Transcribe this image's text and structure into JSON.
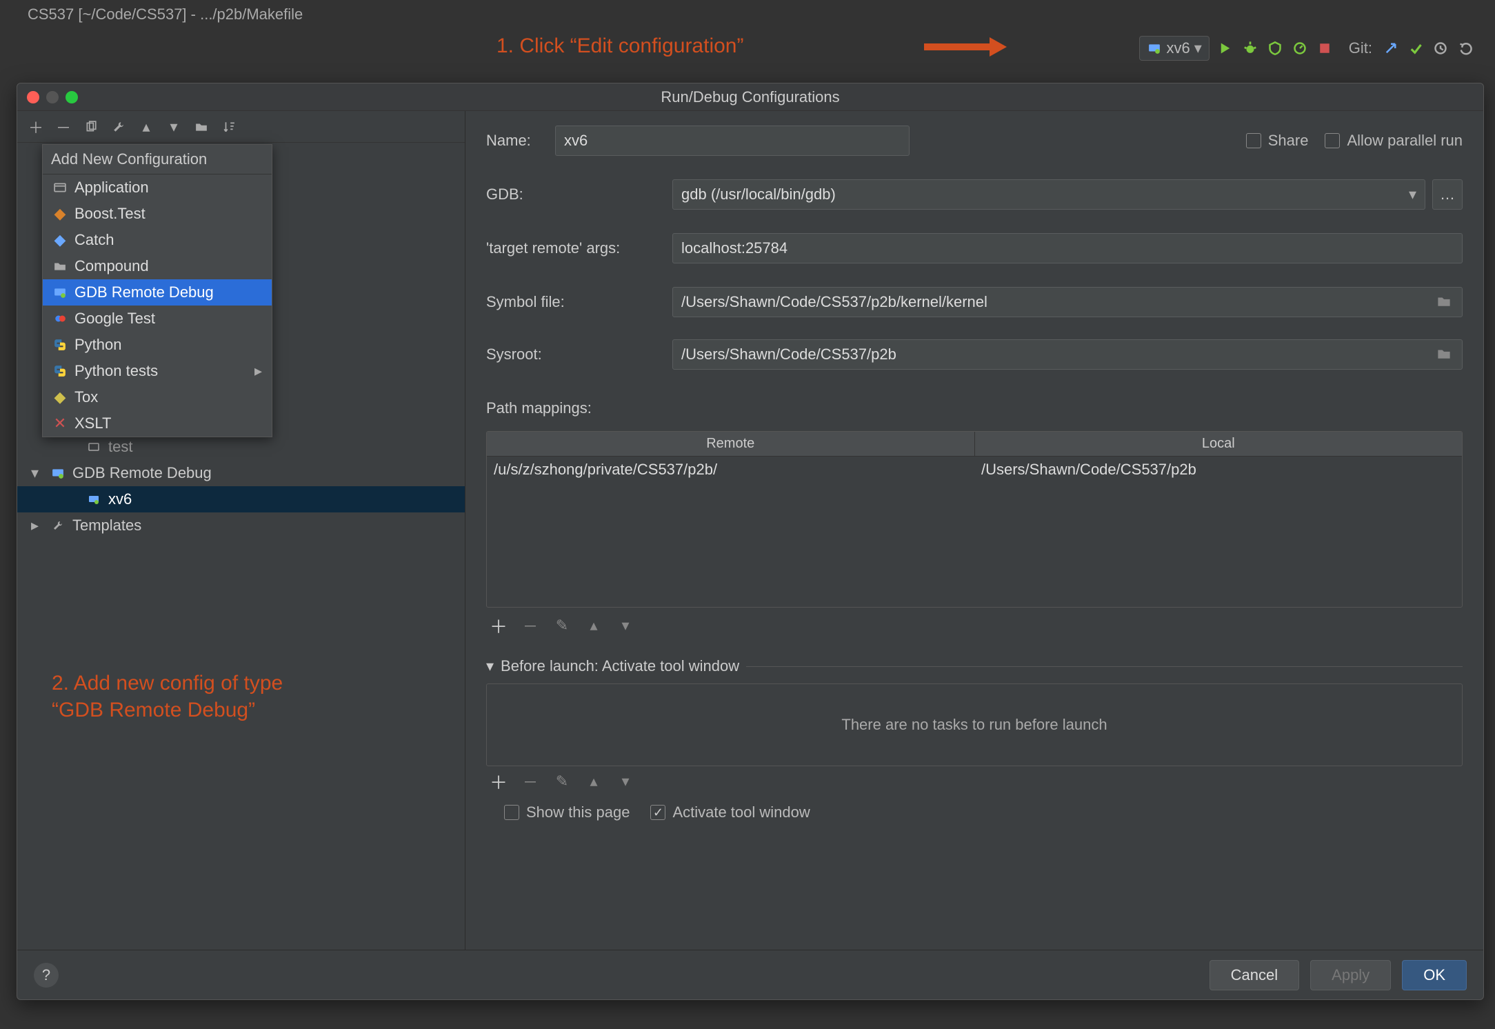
{
  "ide": {
    "title": "CS537 [~/Code/CS537] - .../p2b/Makefile",
    "run_config_label": "xv6",
    "git_label": "Git:"
  },
  "annotations": {
    "step1": "1. Click “Edit configuration”",
    "step2_line1": "2. Add new config of type",
    "step2_line2": "“GDB Remote Debug”"
  },
  "dialog": {
    "title": "Run/Debug Configurations",
    "form": {
      "name_label": "Name:",
      "name_value": "xv6",
      "share_label": "Share",
      "parallel_label": "Allow parallel run",
      "gdb_label": "GDB:",
      "gdb_value": "gdb (/usr/local/bin/gdb)",
      "target_label": "'target remote' args:",
      "target_value": "localhost:25784",
      "symbol_label": "Symbol file:",
      "symbol_value": "/Users/Shawn/Code/CS537/p2b/kernel/kernel",
      "sysroot_label": "Sysroot:",
      "sysroot_value": "/Users/Shawn/Code/CS537/p2b",
      "mappings_label": "Path mappings:",
      "mappings_headers": {
        "remote": "Remote",
        "local": "Local"
      },
      "mappings_rows": [
        {
          "remote": "/u/s/z/szhong/private/CS537/p2b/",
          "local": "/Users/Shawn/Code/CS537/p2b"
        }
      ],
      "before_launch_header": "Before launch: Activate tool window",
      "no_tasks_text": "There are no tasks to run before launch",
      "show_page_label": "Show this page",
      "activate_window_label": "Activate tool window"
    },
    "tree": {
      "test_label": "test",
      "group_label": "GDB Remote Debug",
      "entry_label": "xv6",
      "templates_label": "Templates"
    },
    "popup": {
      "header": "Add New Configuration",
      "items": [
        {
          "label": "Application",
          "icon": "app"
        },
        {
          "label": "Boost.Test",
          "icon": "boost"
        },
        {
          "label": "Catch",
          "icon": "catch"
        },
        {
          "label": "Compound",
          "icon": "folder"
        },
        {
          "label": "GDB Remote Debug",
          "icon": "remote",
          "selected": true
        },
        {
          "label": "Google Test",
          "icon": "gtest"
        },
        {
          "label": "Python",
          "icon": "python"
        },
        {
          "label": "Python tests",
          "icon": "python",
          "submenu": true
        },
        {
          "label": "Tox",
          "icon": "tox"
        },
        {
          "label": "XSLT",
          "icon": "xslt"
        }
      ]
    },
    "buttons": {
      "cancel": "Cancel",
      "apply": "Apply",
      "ok": "OK"
    }
  }
}
